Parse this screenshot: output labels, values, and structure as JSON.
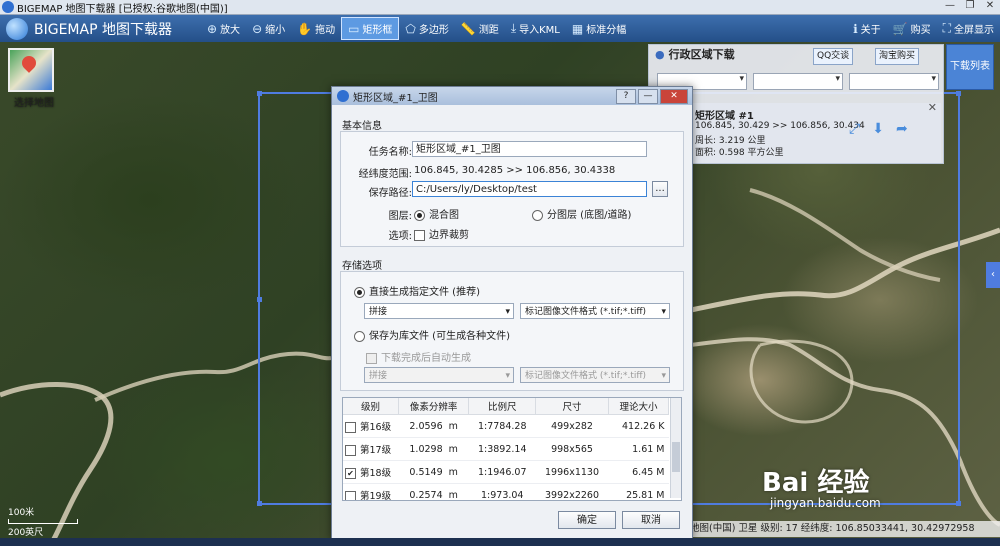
{
  "window": {
    "title": "BIGEMAP 地图下载器 [已授权:谷歌地图(中国)]"
  },
  "toolbar": {
    "brand": "BIGEMAP 地图下载器",
    "buttons": [
      {
        "label": "放大",
        "icon": "zoom-in-icon",
        "glyph": "⊕"
      },
      {
        "label": "缩小",
        "icon": "zoom-out-icon",
        "glyph": "⊖"
      },
      {
        "label": "拖动",
        "icon": "hand-icon",
        "glyph": "✋"
      },
      {
        "label": "矩形框",
        "icon": "rectangle-icon",
        "glyph": "▭",
        "active": true
      },
      {
        "label": "多边形",
        "icon": "polygon-icon",
        "glyph": "⬠"
      },
      {
        "label": "测距",
        "icon": "measure-icon",
        "glyph": "📏"
      },
      {
        "label": "导入KML",
        "icon": "import-icon",
        "glyph": "⤓"
      },
      {
        "label": "标准分幅",
        "icon": "grid-icon",
        "glyph": "▦"
      }
    ],
    "right": [
      {
        "label": "关于",
        "icon": "info-icon",
        "glyph": "ℹ"
      },
      {
        "label": "购买",
        "icon": "cart-icon",
        "glyph": "🛒"
      },
      {
        "label": "全屏显示",
        "icon": "fullscreen-icon",
        "glyph": "⛶"
      }
    ]
  },
  "select_map": {
    "label": "选择地图"
  },
  "admin_panel": {
    "title": "行政区域下载",
    "qq_label": "QQ交谈",
    "taobao_label": "淘宝购买",
    "download_list_label": "下载列表",
    "task": {
      "title": "矩形区域 #1",
      "coords": "106.845, 30.429 >> 106.856, 30.434",
      "perimeter": "周长: 3.219 公里",
      "area": "面积: 0.598 平方公里"
    }
  },
  "dialog": {
    "title": "矩形区域_#1_卫图",
    "basic_legend": "基本信息",
    "task_name_label": "任务名称:",
    "task_name_value": "矩形区域_#1_卫图",
    "range_label": "经纬度范围:",
    "range_value": "106.845, 30.4285   >>   106.856, 30.4338",
    "save_path_label": "保存路径:",
    "save_path_value": "C:/Users/ly/Desktop/test",
    "browse_label": "...",
    "layer_label": "图层:",
    "layer_mixed": "混合图",
    "layer_split": "分图层 (底图/道路)",
    "options_label": "选项:",
    "clip_label": "边界裁剪",
    "storage_legend": "存储选项",
    "direct_label": "直接生成指定文件 (推荐)",
    "mosaic_label": "拼接",
    "format_label": "标记图像文件格式 (*.tif;*.tiff)",
    "save_db_label": "保存为库文件 (可生成各种文件)",
    "auto_gen_label": "下载完成后自动生成",
    "mosaic_label_disabled": "拼接",
    "format_label_disabled": "标记图像文件格式 (*.tif;*.tiff)",
    "table": {
      "headers": [
        "级别",
        "像素分辨率",
        "比例尺",
        "尺寸",
        "理论大小"
      ],
      "rows": [
        {
          "checked": false,
          "level": "第16级",
          "res": "2.0596",
          "unit": "m",
          "scale": "1:7784.28",
          "size": "499x282",
          "theory": "412.26 K"
        },
        {
          "checked": false,
          "level": "第17级",
          "res": "1.0298",
          "unit": "m",
          "scale": "1:3892.14",
          "size": "998x565",
          "theory": "1.61 M"
        },
        {
          "checked": true,
          "level": "第18级",
          "res": "0.5149",
          "unit": "m",
          "scale": "1:1946.07",
          "size": "1996x1130",
          "theory": "6.45 M"
        },
        {
          "checked": false,
          "level": "第19级",
          "res": "0.2574",
          "unit": "m",
          "scale": "1:973.04",
          "size": "3992x2260",
          "theory": "25.81 M"
        }
      ]
    },
    "ok_label": "确定",
    "cancel_label": "取消"
  },
  "status_bar": {
    "text": "地图(中国) 卫星   级别: 17  经纬度: 106.85033441, 30.42972958"
  },
  "scale": {
    "top": "100米",
    "bottom": "200英尺"
  },
  "watermark": {
    "main": "Bai 经验",
    "sub": "jingyan.baidu.com"
  }
}
